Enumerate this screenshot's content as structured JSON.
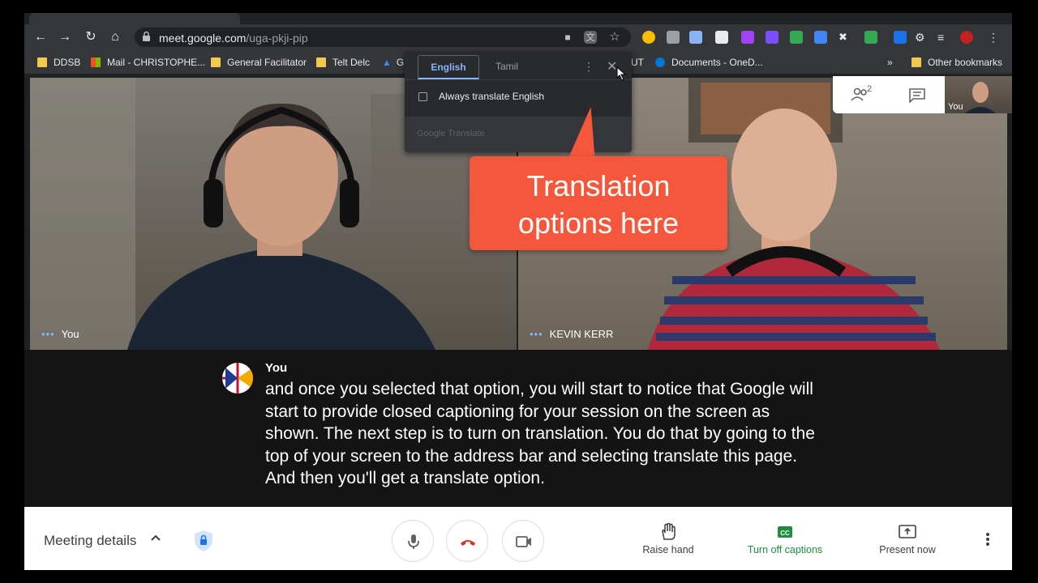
{
  "browser": {
    "url_host": "meet.google.com",
    "url_path": "/uga-pkji-pip",
    "bookmarks": [
      {
        "label": "DDSB"
      },
      {
        "label": "Mail - CHRISTOPHE..."
      },
      {
        "label": "General Facilitator"
      },
      {
        "label": "Telt Delc"
      },
      {
        "label": "G"
      },
      {
        "label": "UT"
      },
      {
        "label": "Documents - OneD..."
      }
    ],
    "more_bookmarks": "»",
    "other_bookmarks": "Other bookmarks",
    "participant_count_badge": "2"
  },
  "translate_popup": {
    "tab_source": "English",
    "tab_target": "Tamil",
    "always_translate": "Always translate English",
    "footer": "Google Translate"
  },
  "callout": {
    "line1": "Translation",
    "line2": "options here",
    "color": "#f4573b"
  },
  "tiles": [
    {
      "name": "You"
    },
    {
      "name": "KEVIN KERR"
    }
  ],
  "self_view": {
    "label": "You"
  },
  "caption": {
    "speaker": "You",
    "text": "and once you selected that option, you will start to notice that Google will start to provide closed captioning for your session on the screen as shown. The next step is to turn on translation. You do that by going to the top of your screen to the address bar and selecting translate this page. And then you'll get a translate option."
  },
  "bottom_bar": {
    "meeting_details": "Meeting details",
    "raise_hand": "Raise hand",
    "captions": "Turn off captions",
    "present": "Present now",
    "captions_color": "#1e8e3e",
    "hangup_color": "#d93025"
  }
}
